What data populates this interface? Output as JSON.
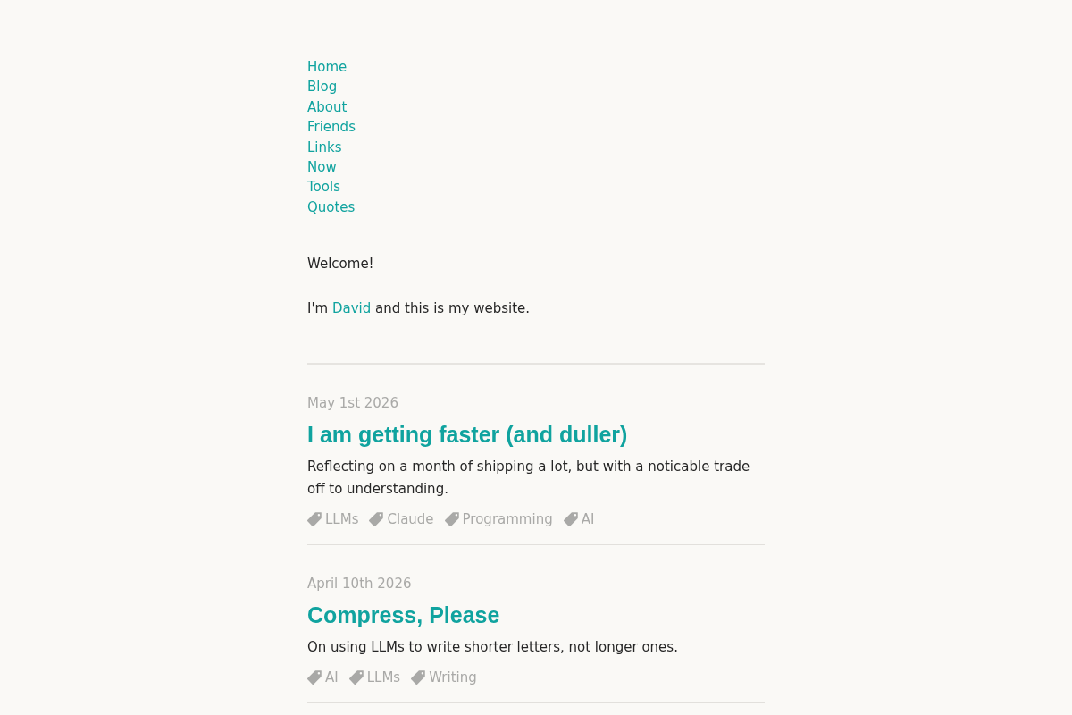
{
  "nav": {
    "items": [
      "Home",
      "Blog",
      "About",
      "Friends",
      "Links",
      "Now",
      "Tools",
      "Quotes"
    ]
  },
  "intro": {
    "greeting": "Welcome!",
    "line": {
      "before": "I'm ",
      "link": "David",
      "after": " and this is my website."
    }
  },
  "posts": [
    {
      "date": "May 1st 2026",
      "title": "I am getting faster (and duller)",
      "summary": "Reflecting on a month of shipping a lot, but with a noticable trade off to understanding.",
      "tags": [
        "LLMs",
        "Claude",
        "Programming",
        "AI"
      ]
    },
    {
      "date": "April 10th 2026",
      "title": "Compress, Please",
      "summary": "On using LLMs to write shorter letters, not longer ones.",
      "tags": [
        "AI",
        "LLMs",
        "Writing"
      ]
    }
  ]
}
